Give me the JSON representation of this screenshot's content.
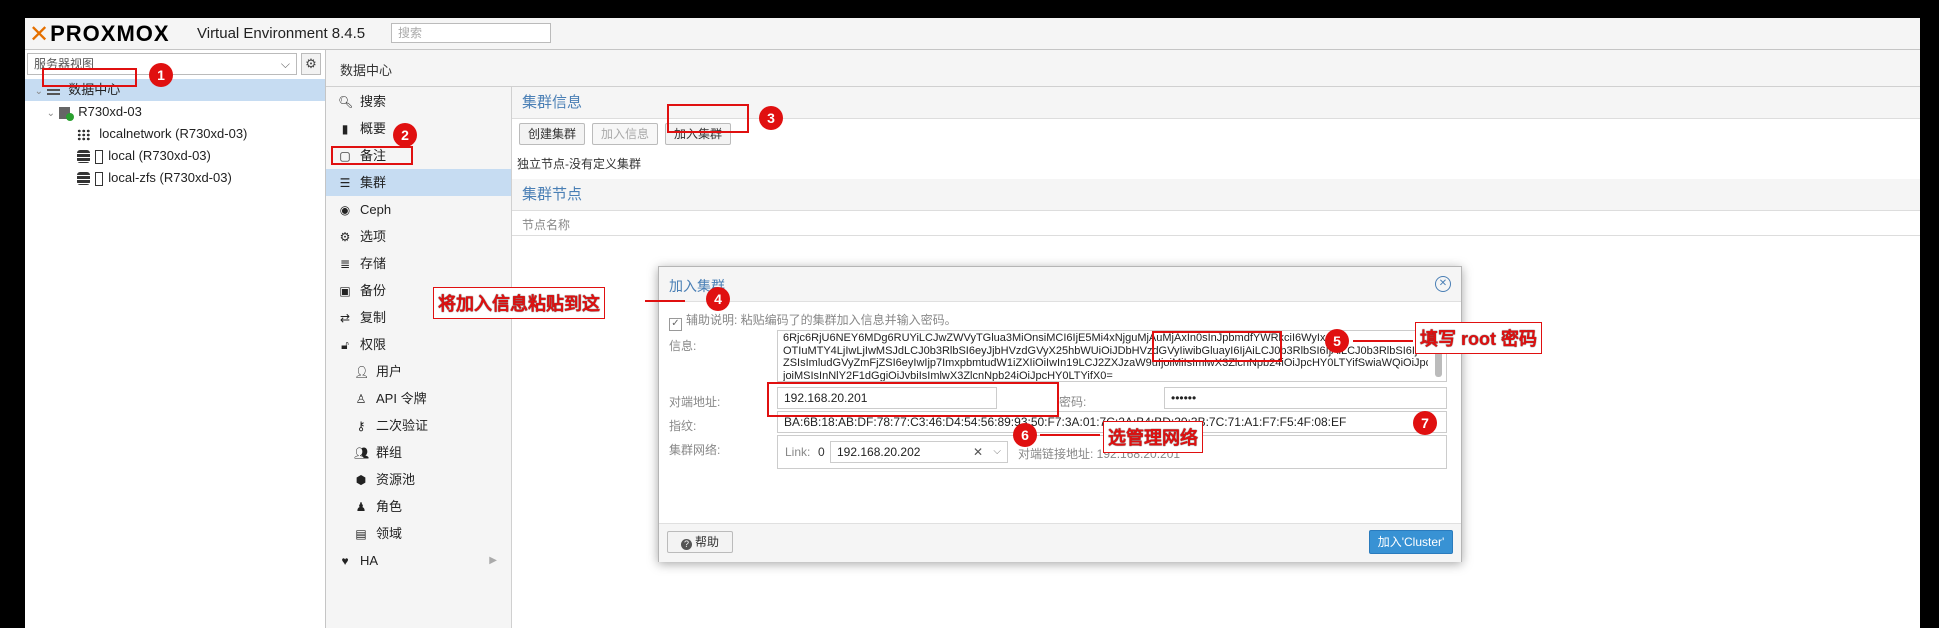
{
  "topbar": {
    "logo_text": "PROXMOX",
    "product": "Virtual Environment 8.4.5",
    "search_placeholder": "搜索"
  },
  "tree": {
    "view_select": "服务器视图",
    "items": [
      {
        "label": "数据中心",
        "icon": "datacenter-icon"
      },
      {
        "label": "R730xd-03",
        "icon": "node-online-icon"
      },
      {
        "label": "localnetwork (R730xd-03)",
        "icon": "network-grid-icon"
      },
      {
        "label": "local (R730xd-03)",
        "icon": "storage-icon"
      },
      {
        "label": "local-zfs (R730xd-03)",
        "icon": "storage-icon"
      }
    ]
  },
  "breadcrumb": "数据中心",
  "nav": [
    {
      "label": "搜索",
      "icon": "search-icon"
    },
    {
      "label": "概要",
      "icon": "book-icon"
    },
    {
      "label": "备注",
      "icon": "note-icon"
    },
    {
      "label": "集群",
      "icon": "cluster-icon"
    },
    {
      "label": "Ceph",
      "icon": "ceph-icon"
    },
    {
      "label": "选项",
      "icon": "gear-icon"
    },
    {
      "label": "存储",
      "icon": "database-icon"
    },
    {
      "label": "备份",
      "icon": "floppy-icon"
    },
    {
      "label": "复制",
      "icon": "retweet-icon"
    },
    {
      "label": "权限",
      "icon": "unlock-icon"
    },
    {
      "label": "用户",
      "icon": "user-icon"
    },
    {
      "label": "API 令牌",
      "icon": "user-outline-icon"
    },
    {
      "label": "二次验证",
      "icon": "key-icon"
    },
    {
      "label": "群组",
      "icon": "users-icon"
    },
    {
      "label": "资源池",
      "icon": "tags-icon"
    },
    {
      "label": "角色",
      "icon": "male-icon"
    },
    {
      "label": "领域",
      "icon": "address-book-icon"
    },
    {
      "label": "HA",
      "icon": "heartbeat-icon"
    }
  ],
  "cluster": {
    "info_header": "集群信息",
    "create_btn": "创建集群",
    "join_info_btn": "加入信息",
    "join_btn": "加入集群",
    "standalone_text": "独立节点-没有定义集群",
    "nodes_header": "集群节点",
    "node_col": "节点名称"
  },
  "dialog": {
    "title": "加入集群",
    "assist_label": "辅助说明: 粘贴编码了的集群加入信息并输入密码。",
    "info_label": "信息:",
    "info_value": "6Rjc6RjU6NEY6MDg6RUYiLCJwZWVyTGlua3MiOnsiMCI6IjE5Mi4xNjguMjAuMjAxIn0sInJpbmdfYWRkciI6WyIxOTIuMTY4LjIwLjIwMSJdLCJ0b3RlbSI6eyJjbHVzdGVyX25hbWUiOiJDbHVzdGVyIiwibGluayI6IjAiLCJ0b3RlbUlmbWdicnIiOiJ6ZXJtYS1jb2xsSWQiOiJDbHVzdGVyIiwidmVyc2lvbiI6IjIiLCJpcF92ZXJzaW9uIjoiaXB2NC02In0sImZpbmdlcnByaW50IjoiZGdlQUQ0OTcyNiIsInJpbmcwX2FkZHIiOlsiMTkyLjE2OC4yMC4yMDEiXX0jSmxpbmtfbW9kZSI6InBhc3NpdmUiLCJzZWNhdXRoIjoib24iLCJ2ZXJzaW9uIjoiMiIsImlwX3ZlcnNpb24iOiJpcHY0LTYifSwiaWQiOiJpcHY0LTYifQ==",
    "info_lines": [
      "6Rjc6RjU6NEY6MDg6RUYiLCJwZWVyTGlua3MiOnsiMCI6IjE5Mi4xNjguMjAuMjAxIn0sInJpbmdfYWRkciI6WyIx",
      "OTIuMTY4LjIwLjIwMSJdLCJ0b3RlbSI6eyJjbHVzdGVyX25hbWUiOiJDbHVzdGVyIiwibGluayI6IjAiLCJ0b3RlbSI6IjAiLCJ0b3RlbSI6IjAiLCJpcF92ZXJzaW9uIjoiaXB2NC02In0sImZpbmdlcnByaW50IjoiZGdlQUQ0OTcyNiIsInJpbmcwX2FkZHIiOlsiMTkyLjE2OC4yMC4yMDEiXX0",
      "ZSIsImludGVyZmFjZSI6eyIwIjp7ImxpbmtudW1iZXIiOiIwIn19LCJ2ZXJzaW9uIjoiMiIsImlwX3ZlcnNpb24iOiJpcHY0LTYifSwiaWQiOiJpcHY0LTYifQ",
      "joiMSIsInNlY2F1dGgiOiJvbiIsImlwX3ZlcnNpb24iOiJpcHY0LTYifX0="
    ],
    "peer_label": "对端地址:",
    "peer_value": "192.168.20.201",
    "password_label": "密码:",
    "password_value": "••••••",
    "fingerprint_label": "指纹:",
    "fingerprint_value": "BA:6B:18:AB:DF:78:77:C3:46:D4:54:56:89:93:50:F7:3A:01:7C:2A:B4:BD:30:3B:7C:71:A1:F7:F5:4F:08:EF",
    "network_label": "集群网络:",
    "link_label": "Link:",
    "link_num": "0",
    "link_value": "192.168.20.202",
    "peer_link_label": "对端链接地址: 192.168.20.201",
    "help_btn": "帮助",
    "join_submit": "加入'Cluster'"
  },
  "annotations": {
    "badges": [
      "1",
      "2",
      "3",
      "4",
      "5",
      "6",
      "7"
    ],
    "note_paste": "将加入信息粘贴到这",
    "note_root": "填写 root 密码",
    "note_network": "选管理网络"
  },
  "colors": {
    "annotation_red": "#e01010",
    "selection": "#c6dcf2",
    "accent_blue": "#4a7fb5",
    "proxmox_orange": "#e57000"
  }
}
